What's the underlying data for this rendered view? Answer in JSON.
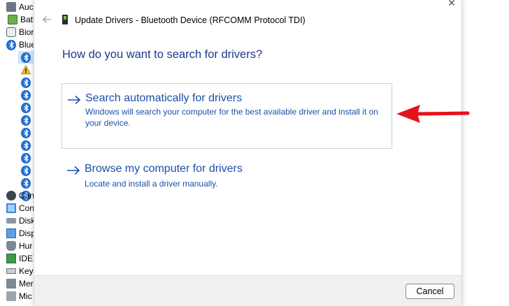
{
  "background": {
    "tree_items": [
      {
        "label": "Auc",
        "icon": "speaker-icon"
      },
      {
        "label": "Batt",
        "icon": "battery-icon"
      },
      {
        "label": "Bior",
        "icon": "biometric-icon"
      },
      {
        "label": "Blue",
        "icon": "bluetooth-icon"
      },
      {
        "label": "Can",
        "icon": "camera-icon"
      },
      {
        "label": "Con",
        "icon": "monitor-icon"
      },
      {
        "label": "Disk",
        "icon": "disk-icon"
      },
      {
        "label": "Disp",
        "icon": "display-icon"
      },
      {
        "label": "Hur",
        "icon": "hid-icon"
      },
      {
        "label": "IDE",
        "icon": "ide-icon"
      },
      {
        "label": "Key",
        "icon": "keyboard-icon"
      },
      {
        "label": "Mer",
        "icon": "memory-icon"
      },
      {
        "label": "Mic",
        "icon": "microphone-icon"
      }
    ],
    "bluetooth_children_count": 12
  },
  "dialog": {
    "title": "Update Drivers - Bluetooth Device (RFCOMM Protocol TDI)",
    "close_glyph": "✕",
    "heading": "How do you want to search for drivers?",
    "options": [
      {
        "title": "Search automatically for drivers",
        "description": "Windows will search your computer for the best available driver and install it on your device."
      },
      {
        "title": "Browse my computer for drivers",
        "description": "Locate and install a driver manually."
      }
    ],
    "cancel_label": "Cancel"
  },
  "colors": {
    "link_blue": "#1c4fa8",
    "heading_blue": "#1a3a8a",
    "annotation_red": "#e3141b",
    "bluetooth_blue": "#1f6fd6"
  }
}
